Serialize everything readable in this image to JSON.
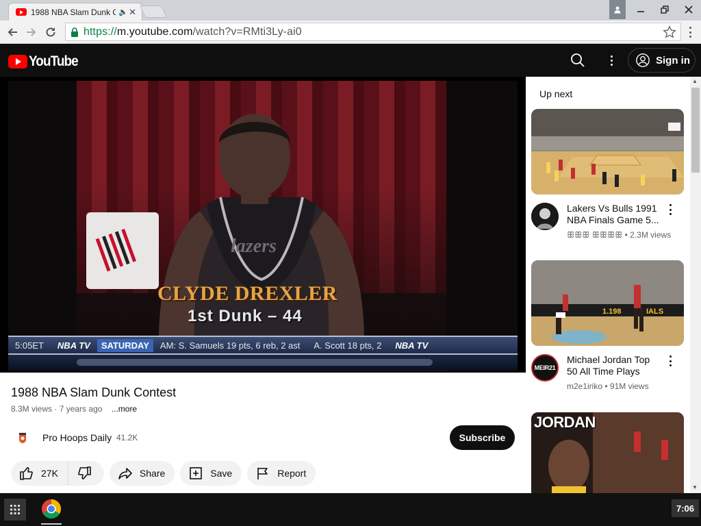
{
  "browser": {
    "tab_title": "1988 NBA Slam Dunk C",
    "url_scheme": "https://",
    "url_host": "m.youtube.com",
    "url_path": "/watch?v=RMti3Ly-ai0"
  },
  "header": {
    "logo_text": "YouTube",
    "signin_label": "Sign in"
  },
  "player": {
    "caption_name": "CLYDE DREXLER",
    "caption_dunk": "1st Dunk  –  44",
    "ticker": {
      "score": "5:05ET",
      "network": "NBA TV",
      "day": "SATURDAY",
      "stat1": "AM: S. Samuels  19 pts, 6 reb, 2 ast",
      "stat2": "A. Scott  18 pts, 2",
      "network_right": "NBA TV"
    }
  },
  "video": {
    "title": "1988 NBA Slam Dunk Contest",
    "views": "8.3M views",
    "age": "7 years ago",
    "more_label": "...more",
    "channel_name": "Pro Hoops Daily",
    "channel_subs": "41.2K",
    "subscribe_label": "Subscribe",
    "likes": "27K",
    "share_label": "Share",
    "save_label": "Save",
    "report_label": "Report"
  },
  "upnext": {
    "label": "Up next",
    "items": [
      {
        "title": "Lakers Vs Bulls 1991 NBA Finals Game 5...",
        "channel": "ꕥꕥꕥ ꕥꕥꕥꕥ",
        "views": "2.3M views"
      },
      {
        "title": "Michael Jordan Top 50 All Time Plays",
        "channel": "m2e1iriko",
        "views": "91M views",
        "avatar_text": "MEIR21"
      },
      {
        "title": "JORDAN",
        "channel": "",
        "views": ""
      }
    ]
  },
  "shelf": {
    "clock": "7:06"
  },
  "colors": {
    "youtube_red": "#ff0000",
    "header_bg": "#0f0f0f",
    "pill_bg": "#f2f2f2"
  },
  "icons": [
    "youtube-favicon",
    "speaker-icon",
    "close-icon",
    "user-icon",
    "minimize-icon",
    "restore-icon",
    "back-icon",
    "forward-icon",
    "reload-icon",
    "lock-icon",
    "star-icon",
    "search-icon",
    "more-icon",
    "account-icon",
    "like-icon",
    "dislike-icon",
    "share-icon",
    "save-icon",
    "report-icon",
    "launcher-icon",
    "chrome-icon"
  ]
}
